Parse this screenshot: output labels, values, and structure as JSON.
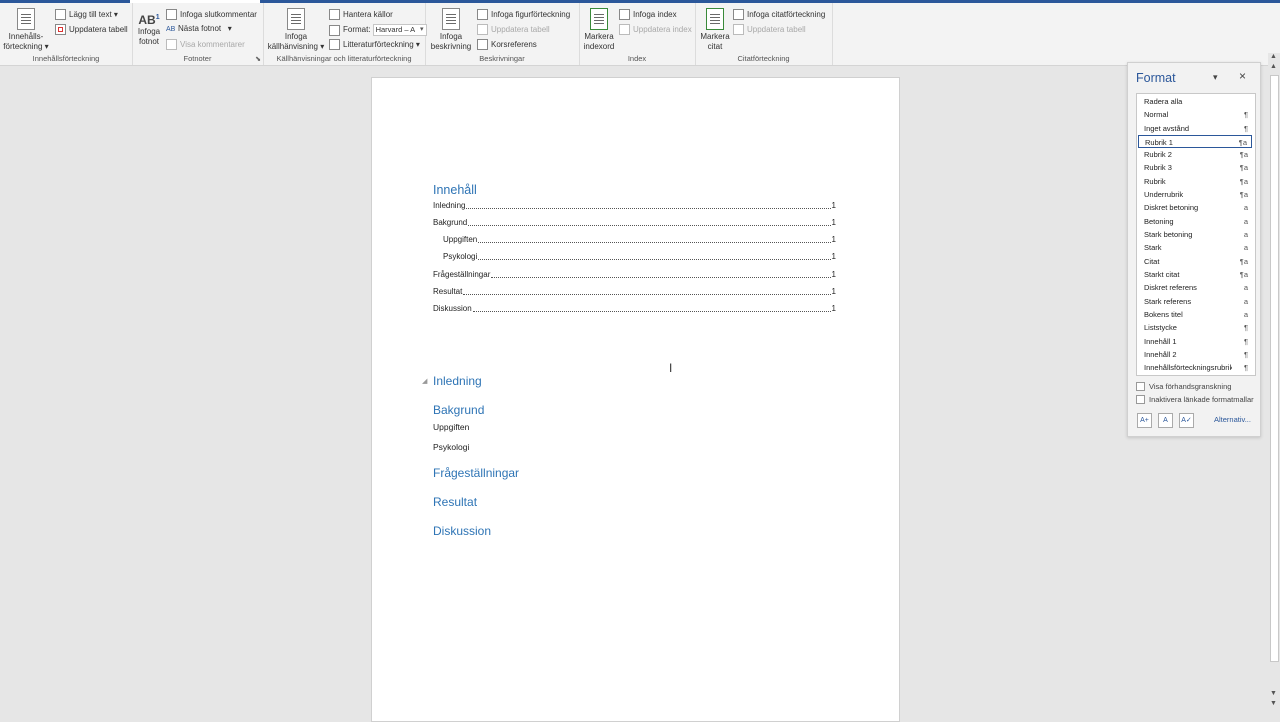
{
  "ribbon": {
    "groups": [
      {
        "label": "Innehållsförteckning"
      },
      {
        "label": "Fotnoter"
      },
      {
        "label": "Källhänvisningar och litteraturförteckning"
      },
      {
        "label": "Beskrivningar"
      },
      {
        "label": "Index"
      },
      {
        "label": "Citatförteckning"
      }
    ],
    "toc": {
      "big_line1": "Innehålls-",
      "big_line2": "förteckning",
      "add_text": "Lägg till text",
      "update_table": "Uppdatera tabell"
    },
    "footnotes": {
      "big_line1": "Infoga",
      "big_line2": "fotnot",
      "big_icon_text": "AB",
      "endnote": "Infoga slutkommentar",
      "next_footnote": "Nästa fotnot",
      "show_notes": "Visa kommentarer"
    },
    "citations": {
      "big_line1": "Infoga",
      "big_line2": "källhänvisning",
      "manage_sources": "Hantera källor",
      "format_label": "Format:",
      "format_value": "Harvard – A",
      "bibliography": "Litteraturförteckning"
    },
    "captions": {
      "big_line1": "Infoga",
      "big_line2": "beskrivning",
      "insert_tof": "Infoga figurförteckning",
      "update_table": "Uppdatera tabell",
      "crossref": "Korsreferens"
    },
    "index": {
      "big_line1": "Markera",
      "big_line2": "indexord",
      "insert_index": "Infoga index",
      "update_index": "Uppdatera index"
    },
    "authorities": {
      "big_line1": "Markera",
      "big_line2": "citat",
      "insert_toa": "Infoga citatförteckning",
      "update_table": "Uppdatera tabell"
    }
  },
  "document": {
    "toc_title": "Innehåll",
    "toc_entries": [
      {
        "label": "Inledning",
        "page": "1"
      },
      {
        "label": "Bakgrund",
        "page": "1"
      },
      {
        "label": "Uppgiften",
        "page": "1"
      },
      {
        "label": "Psykologi",
        "page": "1"
      },
      {
        "label": "Frågeställningar",
        "page": "1"
      },
      {
        "label": "Resultat",
        "page": "1"
      },
      {
        "label": "Diskussion",
        "page": "1"
      }
    ],
    "headings": {
      "inledning": "Inledning",
      "bakgrund": "Bakgrund",
      "uppgiften": "Uppgiften",
      "psykologi": "Psykologi",
      "fragestallningar": "Frågeställningar",
      "resultat": "Resultat",
      "diskussion": "Diskussion"
    }
  },
  "styles_pane": {
    "title": "Format",
    "items": [
      {
        "name": "Radera alla",
        "mark": ""
      },
      {
        "name": "Normal",
        "mark": "¶"
      },
      {
        "name": "Inget avstånd",
        "mark": "¶"
      },
      {
        "name": "Rubrik 1",
        "mark": "¶a"
      },
      {
        "name": "Rubrik 2",
        "mark": "¶a"
      },
      {
        "name": "Rubrik 3",
        "mark": "¶a"
      },
      {
        "name": "Rubrik",
        "mark": "¶a"
      },
      {
        "name": "Underrubrik",
        "mark": "¶a"
      },
      {
        "name": "Diskret betoning",
        "mark": "a"
      },
      {
        "name": "Betoning",
        "mark": "a"
      },
      {
        "name": "Stark betoning",
        "mark": "a"
      },
      {
        "name": "Stark",
        "mark": "a"
      },
      {
        "name": "Citat",
        "mark": "¶a"
      },
      {
        "name": "Starkt citat",
        "mark": "¶a"
      },
      {
        "name": "Diskret referens",
        "mark": "a"
      },
      {
        "name": "Stark referens",
        "mark": "a"
      },
      {
        "name": "Bokens titel",
        "mark": "a"
      },
      {
        "name": "Liststycke",
        "mark": "¶"
      },
      {
        "name": "Innehåll 1",
        "mark": "¶"
      },
      {
        "name": "Innehåll 2",
        "mark": "¶"
      },
      {
        "name": "Innehållsförteckningsrubrik",
        "mark": "¶"
      }
    ],
    "show_preview": "Visa förhandsgranskning",
    "disable_linked": "Inaktivera länkade formatmallar",
    "options_link": "Alternativ..."
  },
  "colors": {
    "accent": "#2b579a",
    "heading": "#2e74b5"
  }
}
